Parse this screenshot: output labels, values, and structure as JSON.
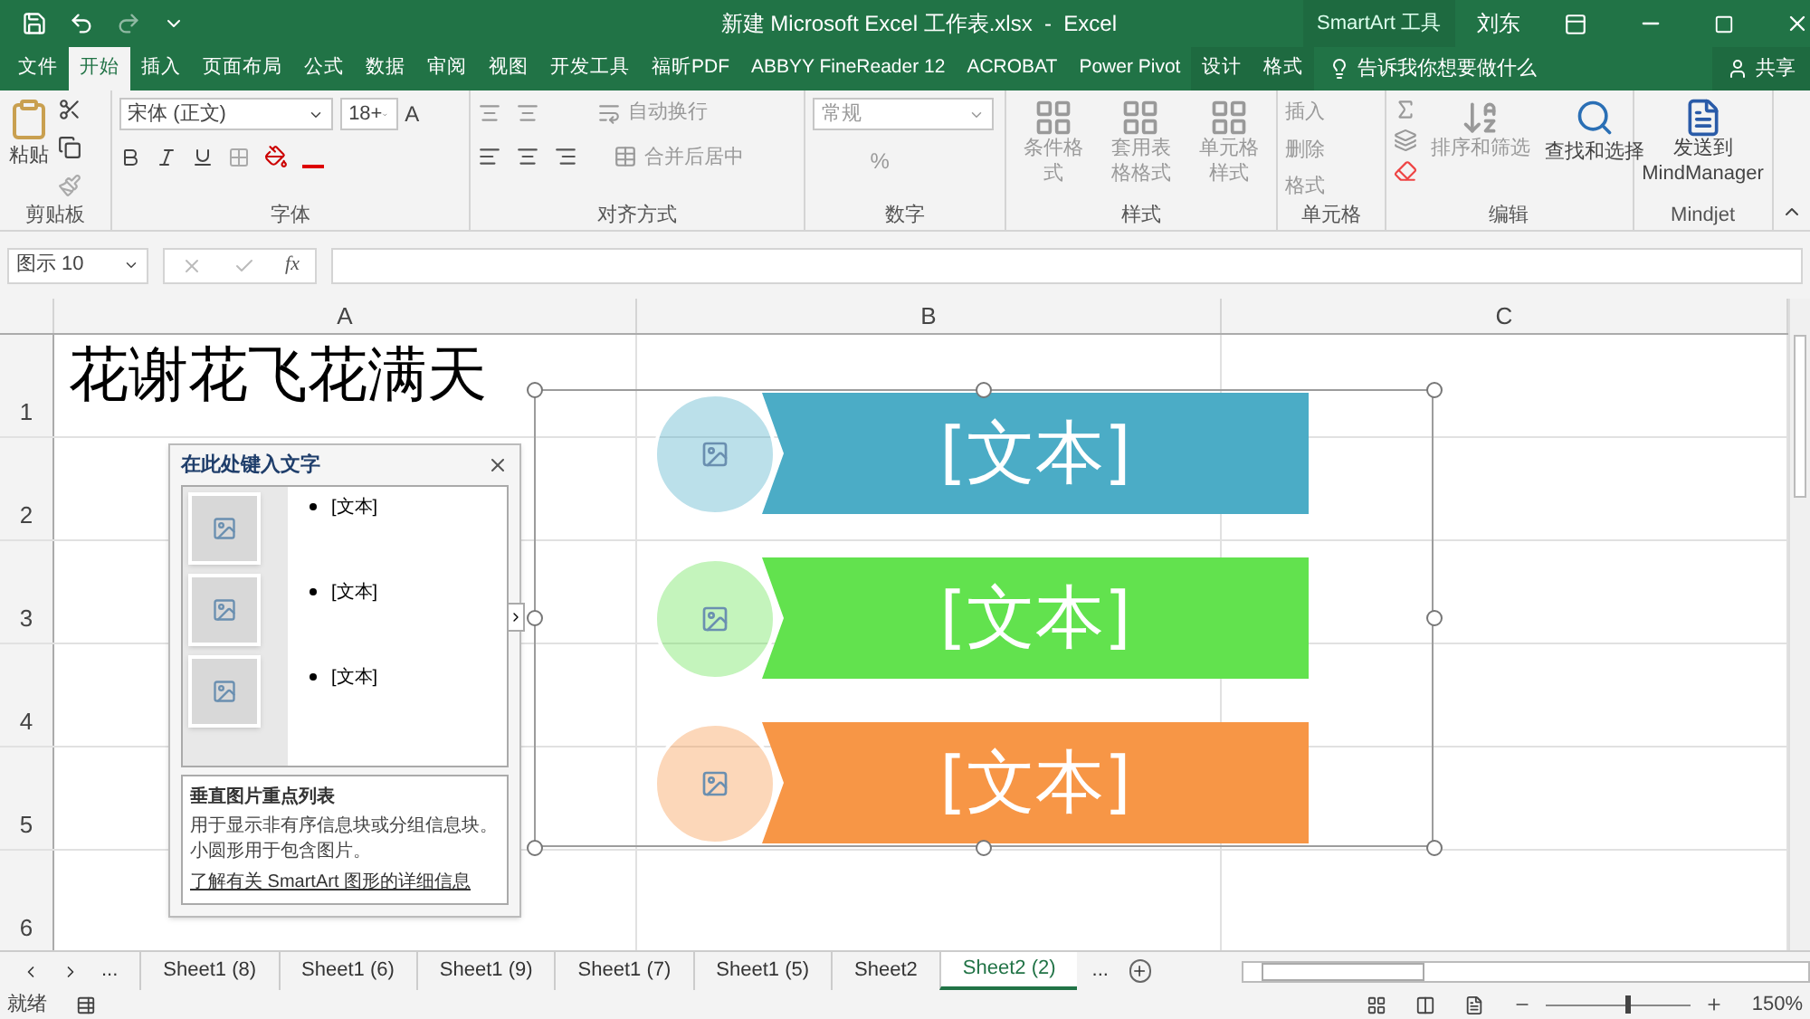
{
  "title_bar": {
    "title": "新建 Microsoft Excel 工作表.xlsx  -  Excel",
    "context_label": "SmartArt 工具",
    "user": "刘东"
  },
  "ribbon_tabs": [
    {
      "label": "文件",
      "selected": false,
      "kind": "normal"
    },
    {
      "label": "开始",
      "selected": true,
      "kind": "normal"
    },
    {
      "label": "插入",
      "selected": false,
      "kind": "normal"
    },
    {
      "label": "页面布局",
      "selected": false,
      "kind": "normal"
    },
    {
      "label": "公式",
      "selected": false,
      "kind": "normal"
    },
    {
      "label": "数据",
      "selected": false,
      "kind": "normal"
    },
    {
      "label": "审阅",
      "selected": false,
      "kind": "normal"
    },
    {
      "label": "视图",
      "selected": false,
      "kind": "normal"
    },
    {
      "label": "开发工具",
      "selected": false,
      "kind": "normal"
    },
    {
      "label": "福昕PDF",
      "selected": false,
      "kind": "normal"
    },
    {
      "label": "ABBYY FineReader 12",
      "selected": false,
      "kind": "normal"
    },
    {
      "label": "ACROBAT",
      "selected": false,
      "kind": "normal"
    },
    {
      "label": "Power Pivot",
      "selected": false,
      "kind": "normal"
    },
    {
      "label": "设计",
      "selected": false,
      "kind": "contextual"
    },
    {
      "label": "格式",
      "selected": false,
      "kind": "contextual"
    }
  ],
  "tell_me": "告诉我你想要做什么",
  "share": "共享",
  "ribbon": {
    "clipboard": {
      "paste": "粘贴",
      "label": "剪贴板"
    },
    "font": {
      "name": "宋体 (正文)",
      "size": "18+",
      "grow": "A",
      "label": "字体"
    },
    "alignment": {
      "wrap": "自动换行",
      "merge": "合并后居中",
      "label": "对齐方式"
    },
    "number": {
      "format": "常规",
      "percent": "%",
      "label": "数字"
    },
    "styles": {
      "buttons": [
        "条件格式",
        "套用表格格式",
        "单元格样式"
      ],
      "label": "样式"
    },
    "cells": {
      "buttons": [
        "插入",
        "删除",
        "格式"
      ],
      "label": "单元格"
    },
    "editing": {
      "buttons": [
        "排序和筛选",
        "查找和选择"
      ],
      "label": "编辑"
    },
    "mindjet": {
      "button": "发送到 MindManager",
      "label": "Mindjet"
    }
  },
  "formula_bar": {
    "name_box": "图示 10",
    "fx": "fx"
  },
  "sheet": {
    "columns": [
      "A",
      "B",
      "C"
    ],
    "rows": [
      "1",
      "2",
      "3",
      "4",
      "5",
      "6"
    ],
    "cell_a1": "花谢花飞花满天"
  },
  "text_pane": {
    "title": "在此处键入文字",
    "items": [
      "[文本]",
      "[文本]",
      "[文本]"
    ],
    "layout_name": "垂直图片重点列表",
    "description": "用于显示非有序信息块或分组信息块。小圆形用于包含图片。",
    "link": "了解有关 SmartArt 图形的详细信息"
  },
  "smartart": [
    {
      "text": "[文本]",
      "color": "#4bacc6"
    },
    {
      "text": "[文本]",
      "color": "#62e24e"
    },
    {
      "text": "[文本]",
      "color": "#f79646"
    }
  ],
  "sheet_tabs": {
    "more_left": "...",
    "tabs": [
      {
        "label": "Sheet1 (8)",
        "selected": false
      },
      {
        "label": "Sheet1 (6)",
        "selected": false
      },
      {
        "label": "Sheet1 (9)",
        "selected": false
      },
      {
        "label": "Sheet1 (7)",
        "selected": false
      },
      {
        "label": "Sheet1 (5)",
        "selected": false
      },
      {
        "label": "Sheet2",
        "selected": false
      },
      {
        "label": "Sheet2 (2)",
        "selected": true
      }
    ],
    "more_right": "..."
  },
  "status_bar": {
    "ready": "就绪",
    "zoom": "150%",
    "level": 0.55
  }
}
